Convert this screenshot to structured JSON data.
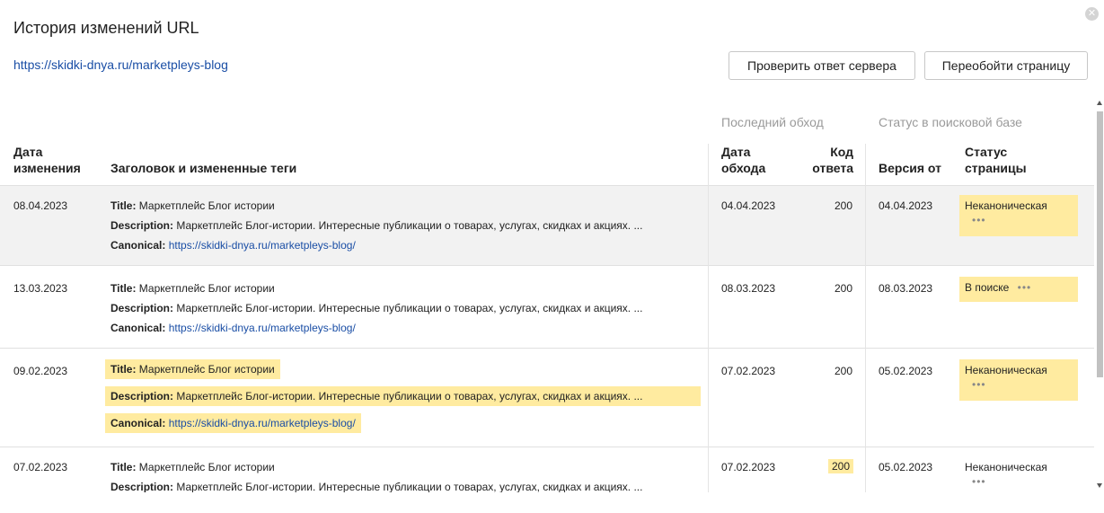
{
  "dialog": {
    "title": "История изменений URL",
    "url": "https://skidki-dnya.ru/marketpleys-blog",
    "check_button": "Проверить ответ сервера",
    "recrawl_button": "Переобойти страницу",
    "close_icon": "close-icon"
  },
  "table": {
    "group_last_crawl": "Последний обход",
    "group_search_status": "Статус в поисковой базе",
    "headers": {
      "change_date_1": "Дата",
      "change_date_2": "изменения",
      "tags": "Заголовок и измененные теги",
      "crawl_date_1": "Дата",
      "crawl_date_2": "обхода",
      "code_1": "Код",
      "code_2": "ответа",
      "version": "Версия от",
      "status_1": "Статус",
      "status_2": "страницы"
    },
    "labels": {
      "title": "Title:",
      "description": "Description:",
      "canonical": "Canonical:"
    },
    "rows": [
      {
        "change_date": "08.04.2023",
        "title": "Маркетплейс Блог истории",
        "description": "Маркетплейс Блог-истории. Интересные публикации о товарах, услугах, скидках и акциях. ...",
        "canonical": "https://skidki-dnya.ru/marketpleys-blog/",
        "crawl_date": "04.04.2023",
        "code": "200",
        "version": "04.04.2023",
        "status": "Неканоническая",
        "dots": "•••"
      },
      {
        "change_date": "13.03.2023",
        "title": "Маркетплейс Блог истории",
        "description": "Маркетплейс Блог-истории. Интересные публикации о товарах, услугах, скидках и акциях. ...",
        "canonical": "https://skidki-dnya.ru/marketpleys-blog/",
        "crawl_date": "08.03.2023",
        "code": "200",
        "version": "08.03.2023",
        "status": "В поиске",
        "dots": "•••"
      },
      {
        "change_date": "09.02.2023",
        "title": "Маркетплейс Блог истории",
        "description": "Маркетплейс Блог-истории. Интересные публикации о товарах, услугах, скидках и акциях. ...",
        "canonical": "https://skidki-dnya.ru/marketpleys-blog/",
        "crawl_date": "07.02.2023",
        "code": "200",
        "version": "05.02.2023",
        "status": "Неканоническая",
        "dots": "•••"
      },
      {
        "change_date": "07.02.2023",
        "title": "Маркетплейс Блог истории",
        "description": "Маркетплейс Блог-истории. Интересные публикации о товарах, услугах, скидках и акциях. ...",
        "crawl_date": "07.02.2023",
        "code": "200",
        "version": "05.02.2023",
        "status": "Неканоническая",
        "dots": "•••"
      }
    ]
  },
  "colors": {
    "link": "#1a4ea5",
    "highlight": "#ffeba0",
    "row_shade": "#f2f2f2"
  }
}
